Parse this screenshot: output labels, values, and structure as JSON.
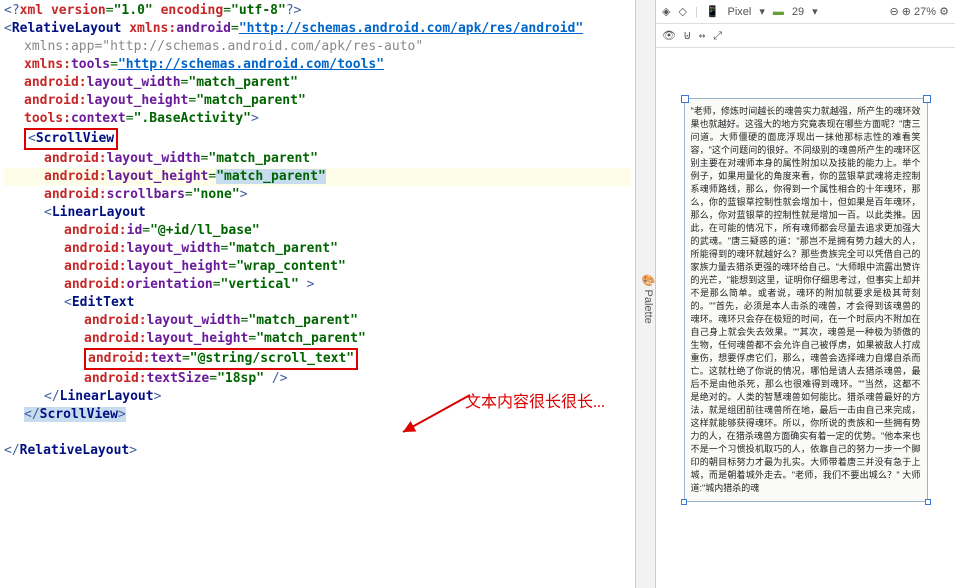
{
  "toolbar": {
    "device": "Pixel",
    "api": "29",
    "zoom": "27%",
    "palette": "Palette"
  },
  "annotation": {
    "text": "文本内容很长很长..."
  },
  "xml": {
    "decl_open": "<?",
    "decl_name": "xml",
    "version_attr": "version",
    "version_val": "\"1.0\"",
    "encoding_attr": "encoding",
    "encoding_val": "\"utf-8\"",
    "decl_close": "?>",
    "root_open": "<",
    "root_tag": "RelativeLayout",
    "xmlns": "xmlns:",
    "android": "android",
    "app": "app",
    "tools": "tools",
    "eq": "=",
    "url_android": "\"http://schemas.android.com/apk/res/android\"",
    "url_app": "\"http://schemas.android.com/apk/res-auto\"",
    "url_tools": "\"http://schemas.android.com/tools\"",
    "ns_android": "android:",
    "attr_lw": "layout_width",
    "attr_lh": "layout_height",
    "attr_sb": "scrollbars",
    "attr_id": "id",
    "attr_orient": "orientation",
    "attr_text": "text",
    "attr_textsize": "textSize",
    "attr_context": "context",
    "val_mp": "\"match_parent\"",
    "val_wc": "\"wrap_content\"",
    "val_none": "\"none\"",
    "val_id": "\"@+id/ll_base\"",
    "val_vert": "\"vertical\"",
    "val_text": "\"@string/scroll_text\"",
    "val_tsize": "\"18sp\"",
    "val_context": "\".BaseActivity\"",
    "gt": ">",
    "scrollview": "ScrollView",
    "linearlayout": "LinearLayout",
    "edittext": "EditText",
    "close_open": "</",
    "slash_gt": " />",
    "tools_ns": "tools:"
  },
  "preview_text": "\"老师，修炼时间越长的魂兽实力就越强，所产生的魂环效果也就越好。这强大的地方究竟表现在哪些方面呢？\"唐三问道。大师僵硬的面庞浮现出一抹他那标志性的难看笑容，\"这个问题问的很好。不同级别的魂兽所产生的魂环区别主要在对魂师本身的属性附加以及技能的能力上。举个例子，如果用量化的角度来看，你的蓝银草武魂将走控制系魂师路线，那么，你得到一个属性相合的十年魂环，那么，你的蓝银草控制性就会增加十，但如果是百年魂环，那么，你对蓝银草的控制性就是增加一百。以此类推。因此，在可能的情况下，所有魂师都会尽量去追求更加强大的武魂。\"唐三疑惑的道：\"那岂不是拥有势力越大的人，所能得到的魂环就越好么？那些贵族完全可以凭借自己的家族力量去猎杀更强的魂环给自己。\"大师眼中流露出赞许的光芒，\"能想到这里，证明你仔细思考过，但事实上却并不是那么简单。或者说，魂环的附加就要求是极其苛刻的。\"\"首先，必须是本人击杀的魂兽，才会得到该魂兽的魂环。魂环只会存在极短的时间，在一个时辰内不附加在自己身上就会失去效果。\"\"其次，魂兽是一种极为骄傲的生物，任何魂兽都不会允许自己被俘虏，如果被敌人打成重伤，想要俘虏它们，那么，魂兽会选择魂力自爆自杀而亡。这就杜绝了你说的情况，哪怕是请人去猎杀魂兽，最后不是由他杀死，那么也很难得到魂环。\"\"当然，这都不是绝对的。人类的智慧魂兽如何能比。猎杀魂兽最好的方法，就是组团前往魂兽所在地，最后一击由自己来完成，这样就能够获得魂环。所以，你所说的贵族和一些拥有势力的人，在猎杀魂兽方面确实有着一定的优势。\"他本来也不是一个习惯投机取巧的人，依靠自己的努力一步一个脚印的朝目标努力才最为扎实。大师带着唐三并没有急于上城，而是朝着城外走去。\"老师，我们不要出城么？\" 大师道:\"城内猎杀的魂"
}
